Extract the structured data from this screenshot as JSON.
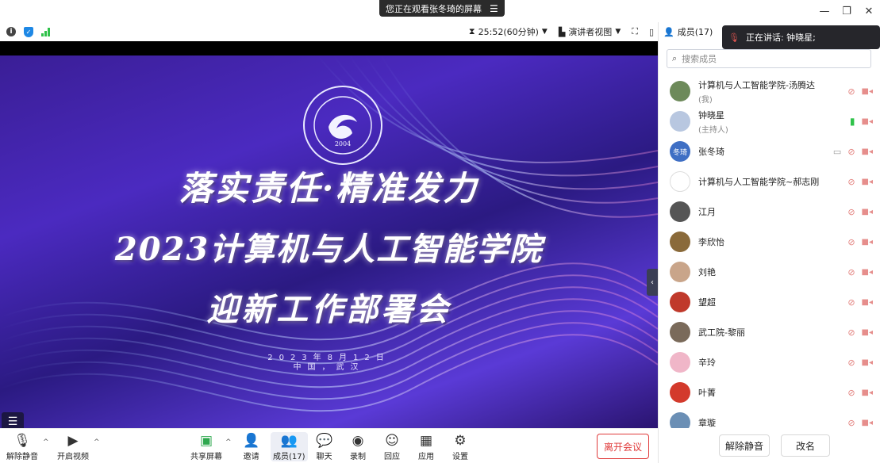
{
  "window": {
    "share_notice": "您正在观看张冬琦的屏幕",
    "controls": [
      "—",
      "❐",
      "✕"
    ]
  },
  "toolbar": {
    "timer": "25:52(60分钟)",
    "view": "演讲者视图"
  },
  "slide": {
    "logo_year": "2004",
    "logo_ring_text": "WUHAN UNIVERSITY OF ENGINEERING SCIENCE",
    "title_line1": "落实责任·精准发力",
    "title_line2": "2023计算机与人工智能学院",
    "title_line3": "迎新工作部署会",
    "date_line1": "2023年8月12日",
    "date_line2": "中国，武汉"
  },
  "bottom_bar": {
    "mute": "解除静音",
    "video": "开启视频",
    "share": "共享屏幕",
    "invite": "邀请",
    "members": "成员(17)",
    "chat": "聊天",
    "record": "录制",
    "react": "回应",
    "apps": "应用",
    "settings": "设置",
    "leave": "离开会议"
  },
  "panel": {
    "title": "成员(17)",
    "speaking": "正在讲话:  钟晓星;",
    "search_placeholder": "搜索成员",
    "members": [
      {
        "name": "计算机与人工智能学院-汤腾达",
        "sub": "(我)",
        "avatar_color": "#6d8a5a",
        "avatar_text": ""
      },
      {
        "name": "钟晓星",
        "sub": "(主持人)",
        "avatar_color": "#b8c7e0",
        "avatar_text": ""
      },
      {
        "name": "张冬琦",
        "sub": "",
        "avatar_color": "#3f6fc4",
        "avatar_text": "冬琦"
      },
      {
        "name": "计算机与人工智能学院~郝志刚",
        "sub": "",
        "avatar_color": "#ffffff",
        "avatar_text": ""
      },
      {
        "name": "江月",
        "sub": "",
        "avatar_color": "#555555",
        "avatar_text": ""
      },
      {
        "name": "李欣怡",
        "sub": "",
        "avatar_color": "#8a6a3a",
        "avatar_text": ""
      },
      {
        "name": "刘艳",
        "sub": "",
        "avatar_color": "#c9a58a",
        "avatar_text": ""
      },
      {
        "name": "望超",
        "sub": "",
        "avatar_color": "#c0392b",
        "avatar_text": ""
      },
      {
        "name": "武工院-黎丽",
        "sub": "",
        "avatar_color": "#7a6a5a",
        "avatar_text": ""
      },
      {
        "name": "辛玲",
        "sub": "",
        "avatar_color": "#f0b6c8",
        "avatar_text": ""
      },
      {
        "name": "叶菁",
        "sub": "",
        "avatar_color": "#d33a2c",
        "avatar_text": ""
      },
      {
        "name": "章璇",
        "sub": "",
        "avatar_color": "#6b8fb5",
        "avatar_text": ""
      }
    ],
    "unmute_all": "解除静音",
    "rename": "改名"
  }
}
